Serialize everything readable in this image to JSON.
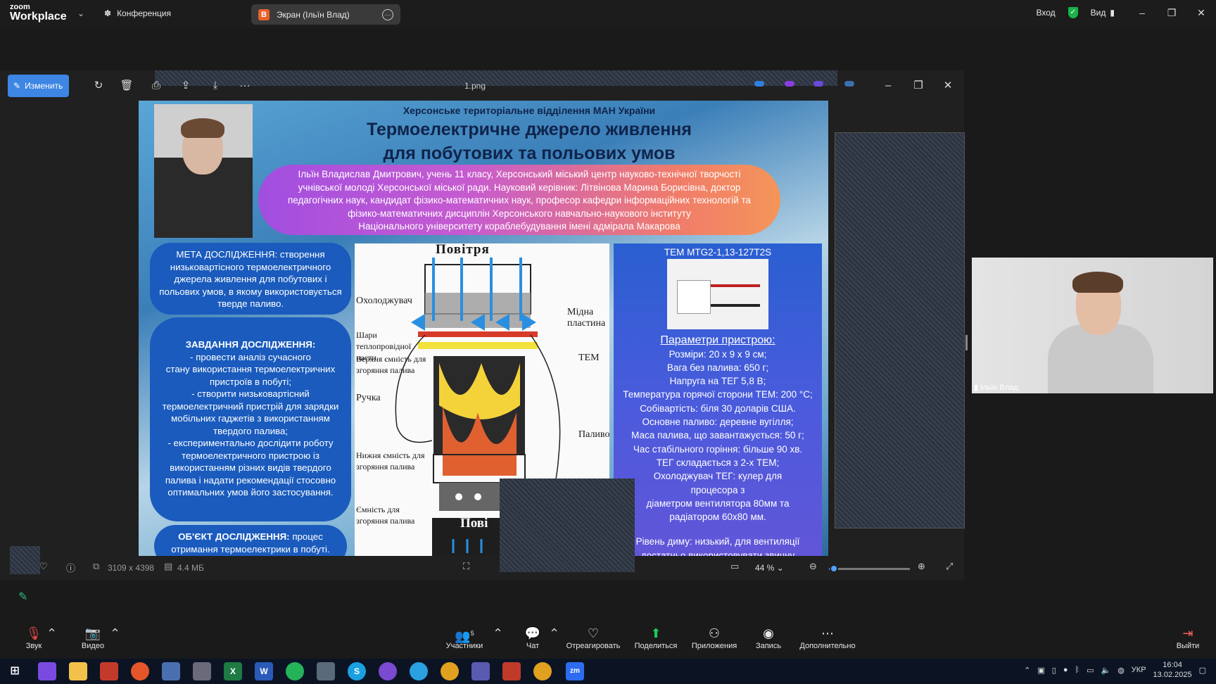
{
  "topbar": {
    "logo_line1": "zoom",
    "logo_line2": "Workplace",
    "conference": "Конференция",
    "screen_badge": "B",
    "screen_label": "Экран (Ільїн Влад)",
    "signin": "Вход",
    "view": "Вид"
  },
  "viewer": {
    "edit_label": "Изменить",
    "filename": "1.png",
    "dimensions": "3109 x 4398",
    "filesize": "4.4 МБ",
    "zoom": "44 %",
    "zoom_fraction": 0.06
  },
  "poster": {
    "org": "Херсонське територіальне відділення МАН України",
    "title_line1": "Термоелектричне джерело живлення",
    "title_line2": "для побутових та польових умов",
    "author_lines": [
      "Ільїн Владислав Дмитрович, учень 11 класу, Херсонський міський центр науково-технічної творчості",
      "учнівської молоді Херсонської міської ради. Науковий керівник: Літвінова Марина Борисівна, доктор",
      "педагогічних наук, кандидат фізико-математичних наук, професор кафедри інформаційних технологій та",
      "фізико-математичних дисциплін Херсонського навчально-наукового інституту",
      "Національного університету кораблебудування імені адмірала Макарова"
    ],
    "goal": "МЕТА ДОСЛІДЖЕННЯ: створення низьковартісного термоелектричного джерела живлення для побутових і польових умов, в якому використовується тверде паливо.",
    "tasks_heading": "ЗАВДАННЯ ДОСЛІДЖЕННЯ:",
    "tasks_lines": [
      "- провести аналіз сучасного",
      "стану використання термоелектричних",
      "пристроїв в побуті;",
      "- створити низьковартісний",
      "термоелектричний пристрій для зарядки",
      "мобільних гаджетів з використанням",
      "твердого палива;",
      "- експериментально дослідити роботу",
      "термоелектричного пристрою із",
      "використанням різних видів твердого",
      "палива і надати рекомендації стосовно",
      "оптимальних умов його застосування."
    ],
    "object_heading": "ОБ'ЄКТ ДОСЛІДЖЕННЯ:",
    "object_text": "процес отримання термоелектрики в побуті.",
    "diagram": {
      "title": "Повітря",
      "cooler": "Охолоджувач",
      "paste": "Шари теплопровідної пасти",
      "upper": "Верхня ємність для згоряння палива",
      "handle": "Ручка",
      "lower": "Нижня ємність для згоряння палива",
      "container": "Ємність для згоряння палива",
      "copper": "Мідна пластина",
      "tem": "ТЕМ",
      "fuel": "Паливо",
      "bottom_air": "Пові"
    },
    "params": {
      "model": "TEM MTG2-1,13-127T2S",
      "heading": "Параметри пристрою:",
      "lines": [
        "Розміри: 20 х 9 х 9 см;",
        "Вага без палива: 650 г;",
        "Напруга на ТЕГ 5,8 В;",
        "Температура горячої сторони ТЕМ: 200 °C;",
        "Собівартість: біля 30 доларів США.",
        "Основне паливо: деревне вугілля;",
        "Маса палива, що завантажується: 50 г;",
        "Час стабільного горіння: більше 90 хв.",
        "ТЕГ складається з 2-х ТЕМ;",
        "Охолоджувач ТЕГ: кулер для",
        "процесора з",
        "діаметром вентилятора 80мм та",
        "радіатором 60х80 мм.",
        "",
        "Рівень диму: низький, для вентиляції",
        "достатньо використовувати звичну"
      ]
    }
  },
  "video": {
    "name": "Ільїн Влад"
  },
  "controls": {
    "audio": "Звук",
    "video": "Видео",
    "participants": "Участники",
    "participants_count": "5",
    "chat": "Чат",
    "react": "Отреагировать",
    "share": "Поделиться",
    "apps": "Приложения",
    "record": "Запись",
    "more": "Дополнительно",
    "leave": "Выйти"
  },
  "taskbar": {
    "lang": "УКР",
    "time": "16:04",
    "date": "13.02.2025"
  },
  "colors": {
    "accent": "#3d86e4",
    "share": "#1fca5a",
    "muted": "#e04545"
  }
}
